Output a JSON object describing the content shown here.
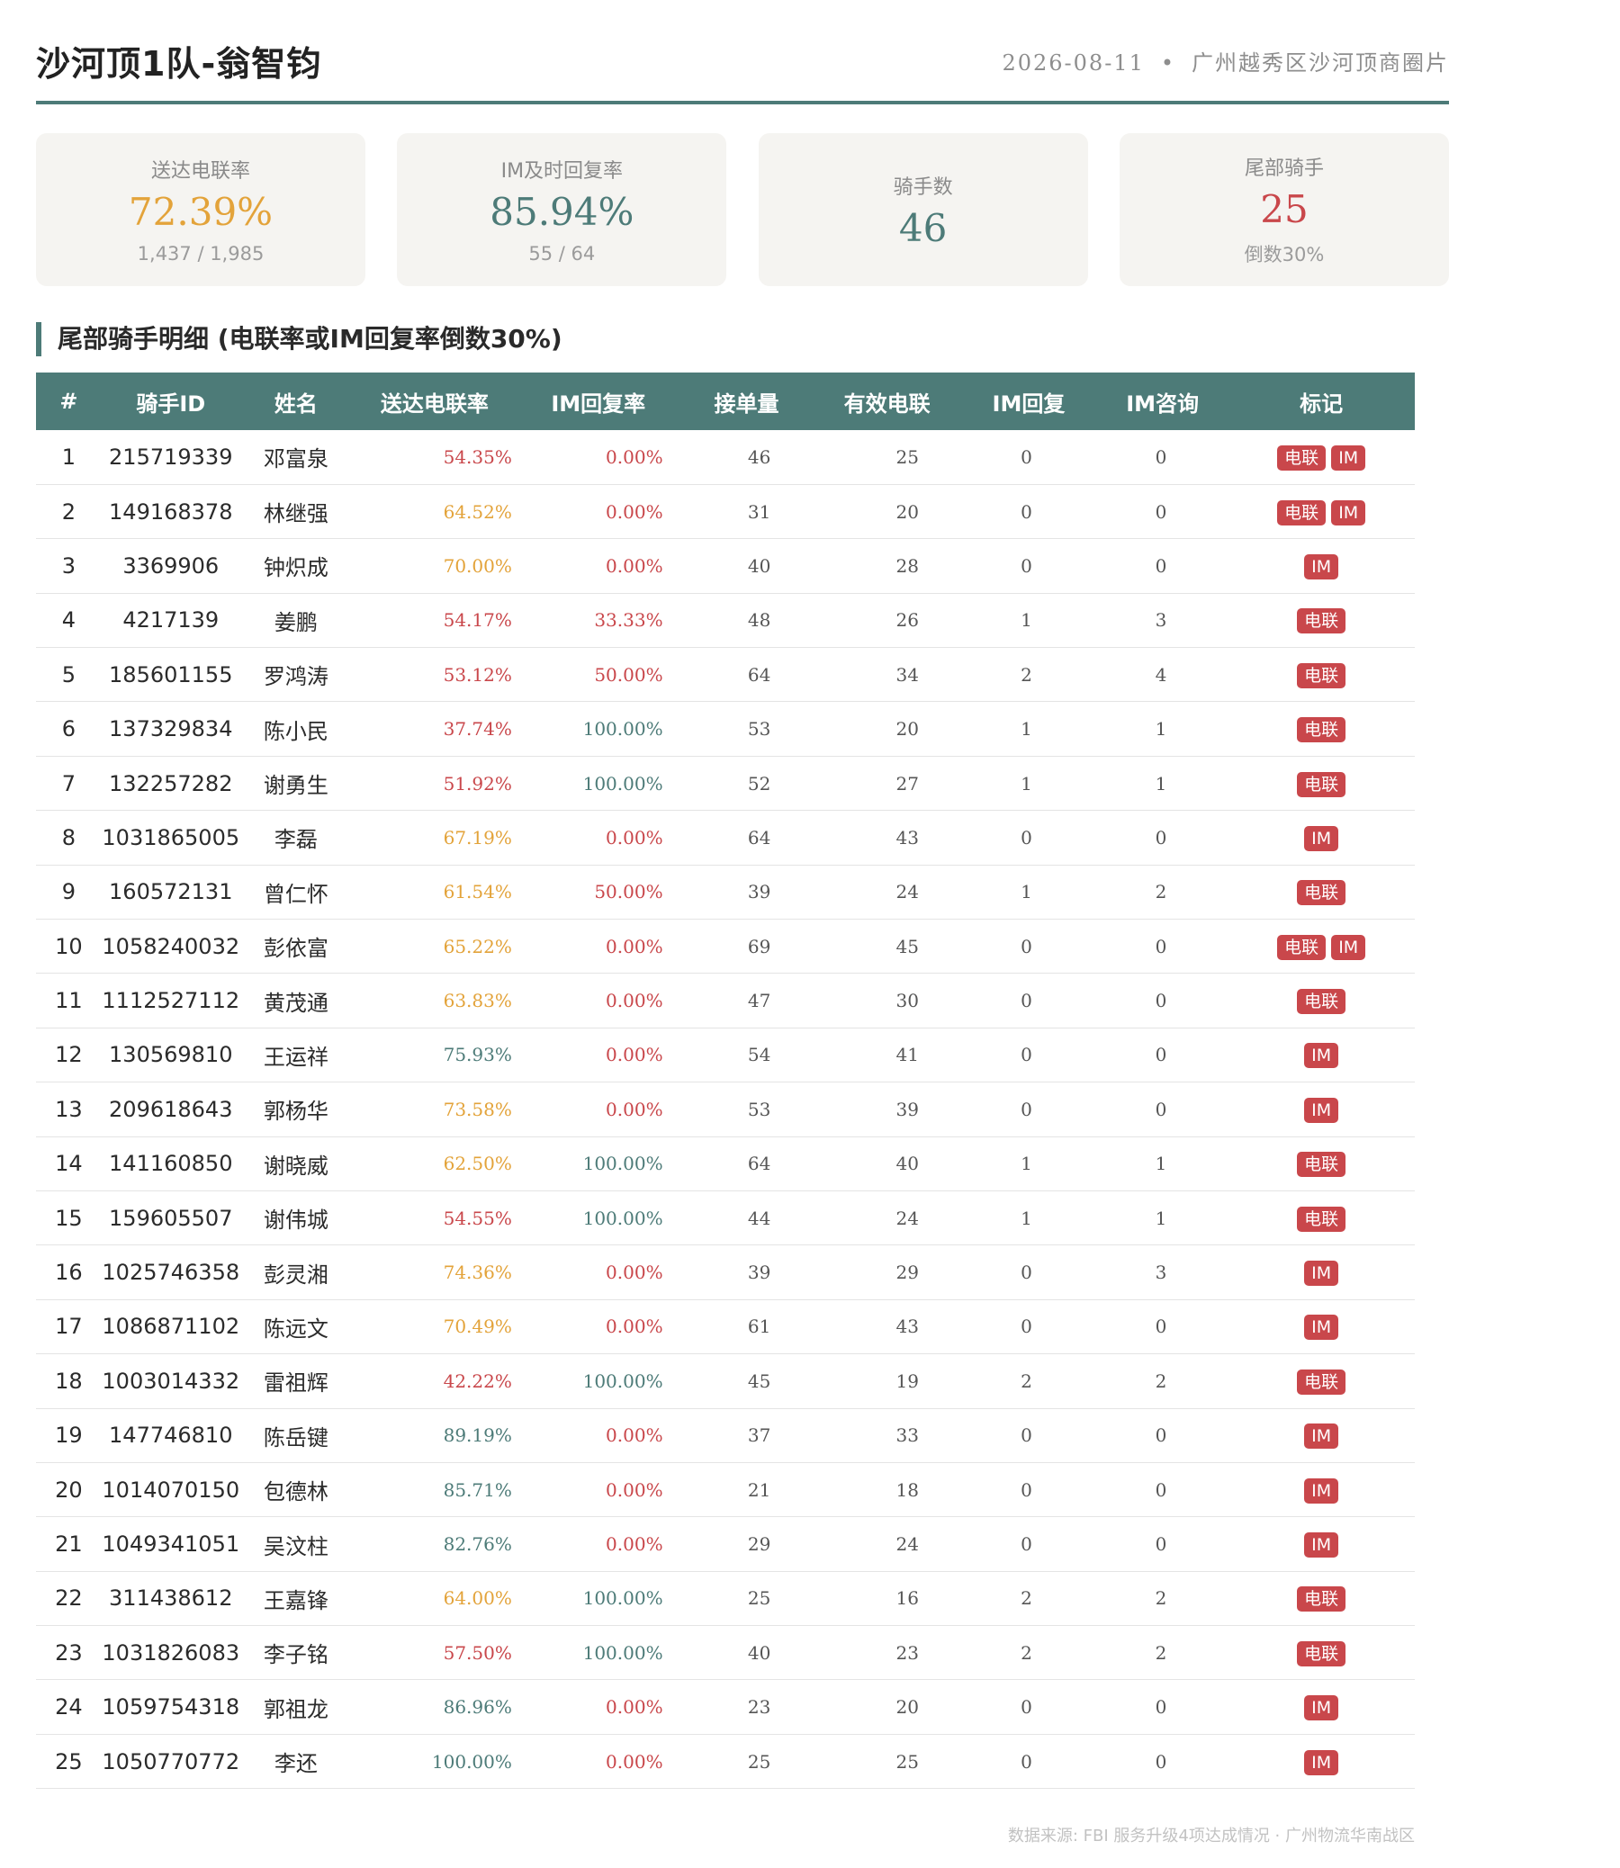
{
  "header": {
    "title": "沙河顶1队-翁智钧",
    "date": "2026-08-11",
    "separator": "•",
    "region": "广州越秀区沙河顶商圈片"
  },
  "cards": [
    {
      "label": "送达电联率",
      "value": "72.39%",
      "sub": "1,437 / 1,985",
      "color": "orange"
    },
    {
      "label": "IM及时回复率",
      "value": "85.94%",
      "sub": "55 / 64",
      "color": "teal"
    },
    {
      "label": "骑手数",
      "value": "46",
      "sub": "",
      "color": "teal"
    },
    {
      "label": "尾部骑手",
      "value": "25",
      "sub": "倒数30%",
      "color": "red"
    }
  ],
  "section_title": "尾部骑手明细 (电联率或IM回复率倒数30%)",
  "table": {
    "columns": [
      "#",
      "骑手ID",
      "姓名",
      "送达电联率",
      "IM回复率",
      "接单量",
      "有效电联",
      "IM回复",
      "IM咨询",
      "标记"
    ],
    "rows": [
      {
        "idx": "1",
        "id": "215719339",
        "name": "邓富泉",
        "del": "54.35%",
        "del_c": "red",
        "im": "0.00%",
        "im_c": "red",
        "orders": "46",
        "eff": "25",
        "imr": "0",
        "imq": "0",
        "tags": [
          "电联",
          "IM"
        ]
      },
      {
        "idx": "2",
        "id": "149168378",
        "name": "林继强",
        "del": "64.52%",
        "del_c": "orange",
        "im": "0.00%",
        "im_c": "red",
        "orders": "31",
        "eff": "20",
        "imr": "0",
        "imq": "0",
        "tags": [
          "电联",
          "IM"
        ]
      },
      {
        "idx": "3",
        "id": "3369906",
        "name": "钟炽成",
        "del": "70.00%",
        "del_c": "orange",
        "im": "0.00%",
        "im_c": "red",
        "orders": "40",
        "eff": "28",
        "imr": "0",
        "imq": "0",
        "tags": [
          "IM"
        ]
      },
      {
        "idx": "4",
        "id": "4217139",
        "name": "姜鹏",
        "del": "54.17%",
        "del_c": "red",
        "im": "33.33%",
        "im_c": "red",
        "orders": "48",
        "eff": "26",
        "imr": "1",
        "imq": "3",
        "tags": [
          "电联"
        ]
      },
      {
        "idx": "5",
        "id": "185601155",
        "name": "罗鸿涛",
        "del": "53.12%",
        "del_c": "red",
        "im": "50.00%",
        "im_c": "red",
        "orders": "64",
        "eff": "34",
        "imr": "2",
        "imq": "4",
        "tags": [
          "电联"
        ]
      },
      {
        "idx": "6",
        "id": "137329834",
        "name": "陈小民",
        "del": "37.74%",
        "del_c": "red",
        "im": "100.00%",
        "im_c": "teal",
        "orders": "53",
        "eff": "20",
        "imr": "1",
        "imq": "1",
        "tags": [
          "电联"
        ]
      },
      {
        "idx": "7",
        "id": "132257282",
        "name": "谢勇生",
        "del": "51.92%",
        "del_c": "red",
        "im": "100.00%",
        "im_c": "teal",
        "orders": "52",
        "eff": "27",
        "imr": "1",
        "imq": "1",
        "tags": [
          "电联"
        ]
      },
      {
        "idx": "8",
        "id": "1031865005",
        "name": "李磊",
        "del": "67.19%",
        "del_c": "orange",
        "im": "0.00%",
        "im_c": "red",
        "orders": "64",
        "eff": "43",
        "imr": "0",
        "imq": "0",
        "tags": [
          "IM"
        ]
      },
      {
        "idx": "9",
        "id": "160572131",
        "name": "曾仁怀",
        "del": "61.54%",
        "del_c": "orange",
        "im": "50.00%",
        "im_c": "red",
        "orders": "39",
        "eff": "24",
        "imr": "1",
        "imq": "2",
        "tags": [
          "电联"
        ]
      },
      {
        "idx": "10",
        "id": "1058240032",
        "name": "彭依富",
        "del": "65.22%",
        "del_c": "orange",
        "im": "0.00%",
        "im_c": "red",
        "orders": "69",
        "eff": "45",
        "imr": "0",
        "imq": "0",
        "tags": [
          "电联",
          "IM"
        ]
      },
      {
        "idx": "11",
        "id": "1112527112",
        "name": "黄茂通",
        "del": "63.83%",
        "del_c": "orange",
        "im": "0.00%",
        "im_c": "red",
        "orders": "47",
        "eff": "30",
        "imr": "0",
        "imq": "0",
        "tags": [
          "电联"
        ]
      },
      {
        "idx": "12",
        "id": "130569810",
        "name": "王运祥",
        "del": "75.93%",
        "del_c": "teal",
        "im": "0.00%",
        "im_c": "red",
        "orders": "54",
        "eff": "41",
        "imr": "0",
        "imq": "0",
        "tags": [
          "IM"
        ]
      },
      {
        "idx": "13",
        "id": "209618643",
        "name": "郭杨华",
        "del": "73.58%",
        "del_c": "orange",
        "im": "0.00%",
        "im_c": "red",
        "orders": "53",
        "eff": "39",
        "imr": "0",
        "imq": "0",
        "tags": [
          "IM"
        ]
      },
      {
        "idx": "14",
        "id": "141160850",
        "name": "谢晓威",
        "del": "62.50%",
        "del_c": "orange",
        "im": "100.00%",
        "im_c": "teal",
        "orders": "64",
        "eff": "40",
        "imr": "1",
        "imq": "1",
        "tags": [
          "电联"
        ]
      },
      {
        "idx": "15",
        "id": "159605507",
        "name": "谢伟城",
        "del": "54.55%",
        "del_c": "red",
        "im": "100.00%",
        "im_c": "teal",
        "orders": "44",
        "eff": "24",
        "imr": "1",
        "imq": "1",
        "tags": [
          "电联"
        ]
      },
      {
        "idx": "16",
        "id": "1025746358",
        "name": "彭灵湘",
        "del": "74.36%",
        "del_c": "orange",
        "im": "0.00%",
        "im_c": "red",
        "orders": "39",
        "eff": "29",
        "imr": "0",
        "imq": "3",
        "tags": [
          "IM"
        ]
      },
      {
        "idx": "17",
        "id": "1086871102",
        "name": "陈远文",
        "del": "70.49%",
        "del_c": "orange",
        "im": "0.00%",
        "im_c": "red",
        "orders": "61",
        "eff": "43",
        "imr": "0",
        "imq": "0",
        "tags": [
          "IM"
        ]
      },
      {
        "idx": "18",
        "id": "1003014332",
        "name": "雷祖辉",
        "del": "42.22%",
        "del_c": "red",
        "im": "100.00%",
        "im_c": "teal",
        "orders": "45",
        "eff": "19",
        "imr": "2",
        "imq": "2",
        "tags": [
          "电联"
        ]
      },
      {
        "idx": "19",
        "id": "147746810",
        "name": "陈岳键",
        "del": "89.19%",
        "del_c": "teal",
        "im": "0.00%",
        "im_c": "red",
        "orders": "37",
        "eff": "33",
        "imr": "0",
        "imq": "0",
        "tags": [
          "IM"
        ]
      },
      {
        "idx": "20",
        "id": "1014070150",
        "name": "包德林",
        "del": "85.71%",
        "del_c": "teal",
        "im": "0.00%",
        "im_c": "red",
        "orders": "21",
        "eff": "18",
        "imr": "0",
        "imq": "0",
        "tags": [
          "IM"
        ]
      },
      {
        "idx": "21",
        "id": "1049341051",
        "name": "吴汶柱",
        "del": "82.76%",
        "del_c": "teal",
        "im": "0.00%",
        "im_c": "red",
        "orders": "29",
        "eff": "24",
        "imr": "0",
        "imq": "0",
        "tags": [
          "IM"
        ]
      },
      {
        "idx": "22",
        "id": "311438612",
        "name": "王嘉锋",
        "del": "64.00%",
        "del_c": "orange",
        "im": "100.00%",
        "im_c": "teal",
        "orders": "25",
        "eff": "16",
        "imr": "2",
        "imq": "2",
        "tags": [
          "电联"
        ]
      },
      {
        "idx": "23",
        "id": "1031826083",
        "name": "李子铭",
        "del": "57.50%",
        "del_c": "red",
        "im": "100.00%",
        "im_c": "teal",
        "orders": "40",
        "eff": "23",
        "imr": "2",
        "imq": "2",
        "tags": [
          "电联"
        ]
      },
      {
        "idx": "24",
        "id": "1059754318",
        "name": "郭祖龙",
        "del": "86.96%",
        "del_c": "teal",
        "im": "0.00%",
        "im_c": "red",
        "orders": "23",
        "eff": "20",
        "imr": "0",
        "imq": "0",
        "tags": [
          "IM"
        ]
      },
      {
        "idx": "25",
        "id": "1050770772",
        "name": "李还",
        "del": "100.00%",
        "del_c": "teal",
        "im": "0.00%",
        "im_c": "red",
        "orders": "25",
        "eff": "25",
        "imr": "0",
        "imq": "0",
        "tags": [
          "IM"
        ]
      }
    ]
  },
  "footer": "数据来源: FBI 服务升级4项达成情况 · 广州物流华南战区",
  "colors": {
    "teal": "#4d7b78",
    "orange": "#e3a33a",
    "red": "#c9474b",
    "card_bg": "#f5f4f1"
  }
}
